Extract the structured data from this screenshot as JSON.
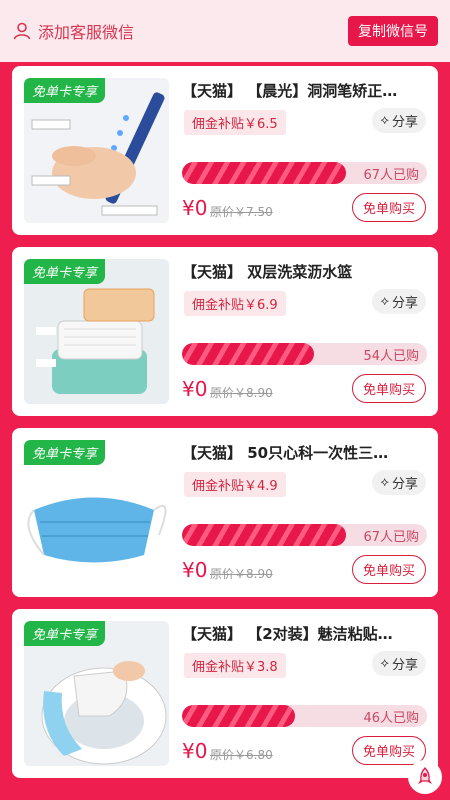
{
  "header": {
    "service_label": "添加客服微信",
    "copy_button": "复制微信号"
  },
  "items": [
    {
      "badge": "免单卡专享",
      "title": "【天猫】 【晨光】洞洞笔矫正…",
      "subsidy": "佣金补贴￥6.5",
      "share": "分享",
      "sold_text": "67人已购",
      "progress": 0.67,
      "price": "¥0",
      "original_price": "原价￥7.50",
      "buy_label": "免单购买",
      "image": "pencil-grip"
    },
    {
      "badge": "免单卡专享",
      "title": "【天猫】 双层洗菜沥水篮",
      "subsidy": "佣金补贴￥6.9",
      "share": "分享",
      "sold_text": "54人已购",
      "progress": 0.54,
      "price": "¥0",
      "original_price": "原价￥8.90",
      "buy_label": "免单购买",
      "image": "drain-basket"
    },
    {
      "badge": "免单卡专享",
      "title": "【天猫】 50只心科一次性三…",
      "subsidy": "佣金补贴￥4.9",
      "share": "分享",
      "sold_text": "67人已购",
      "progress": 0.67,
      "price": "¥0",
      "original_price": "原价￥8.90",
      "buy_label": "免单购买",
      "image": "face-mask"
    },
    {
      "badge": "免单卡专享",
      "title": "【天猫】 【2对装】魅洁粘贴…",
      "subsidy": "佣金补贴￥3.8",
      "share": "分享",
      "sold_text": "46人已购",
      "progress": 0.46,
      "price": "¥0",
      "original_price": "原价￥6.80",
      "buy_label": "免单购买",
      "image": "toilet-seat-pad"
    }
  ],
  "colors": {
    "brand": "#e8174a",
    "badge": "#22b548",
    "background": "#ee1f4f"
  }
}
